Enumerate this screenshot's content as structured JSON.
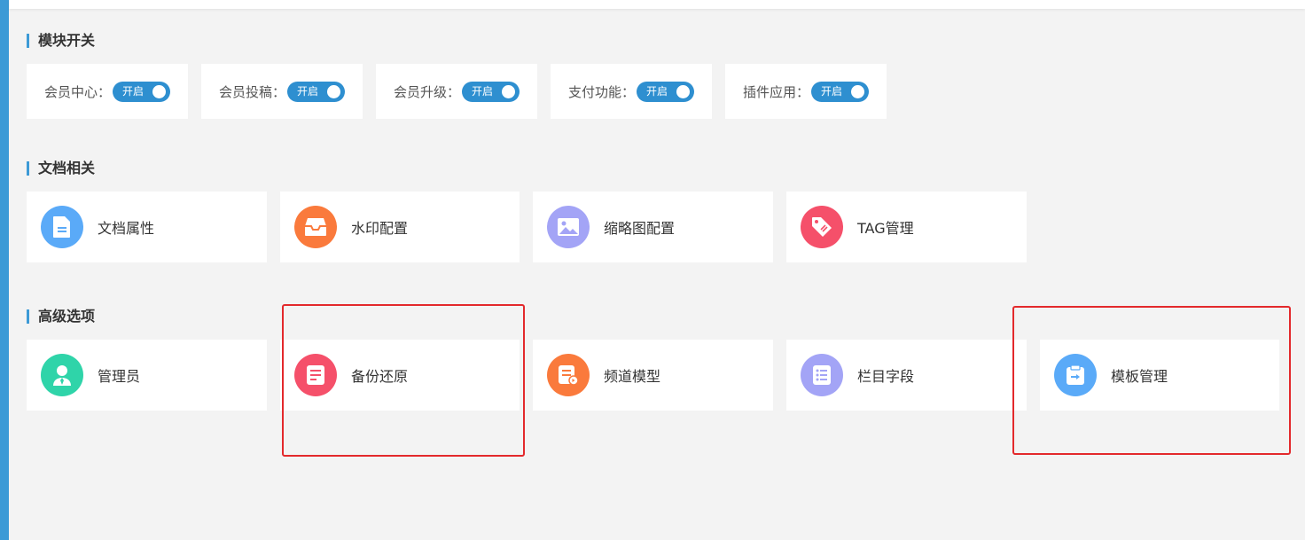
{
  "sections": {
    "modules": {
      "title": "模块开关",
      "switches": [
        {
          "label": "会员中心：",
          "state": "开启"
        },
        {
          "label": "会员投稿：",
          "state": "开启"
        },
        {
          "label": "会员升级：",
          "state": "开启"
        },
        {
          "label": "支付功能：",
          "state": "开启"
        },
        {
          "label": "插件应用：",
          "state": "开启"
        }
      ]
    },
    "documents": {
      "title": "文档相关",
      "items": [
        {
          "label": "文档属性",
          "icon": "document-icon",
          "color": "#5aaaf8"
        },
        {
          "label": "水印配置",
          "icon": "inbox-icon",
          "color": "#fa7a3c"
        },
        {
          "label": "缩略图配置",
          "icon": "image-icon",
          "color": "#a3a4f6"
        },
        {
          "label": "TAG管理",
          "icon": "tag-icon",
          "color": "#f5506a"
        }
      ]
    },
    "advanced": {
      "title": "高级选项",
      "items": [
        {
          "label": "管理员",
          "icon": "user-icon",
          "color": "#2fd4a9"
        },
        {
          "label": "备份还原",
          "icon": "backup-icon",
          "color": "#f5506a"
        },
        {
          "label": "频道模型",
          "icon": "channel-model-icon",
          "color": "#fa7a3c"
        },
        {
          "label": "栏目字段",
          "icon": "list-icon",
          "color": "#a3a4f6"
        },
        {
          "label": "模板管理",
          "icon": "template-icon",
          "color": "#5aaaf8"
        }
      ]
    }
  },
  "accent_color": "#2e8fd0",
  "highlight_color": "#e3292c"
}
